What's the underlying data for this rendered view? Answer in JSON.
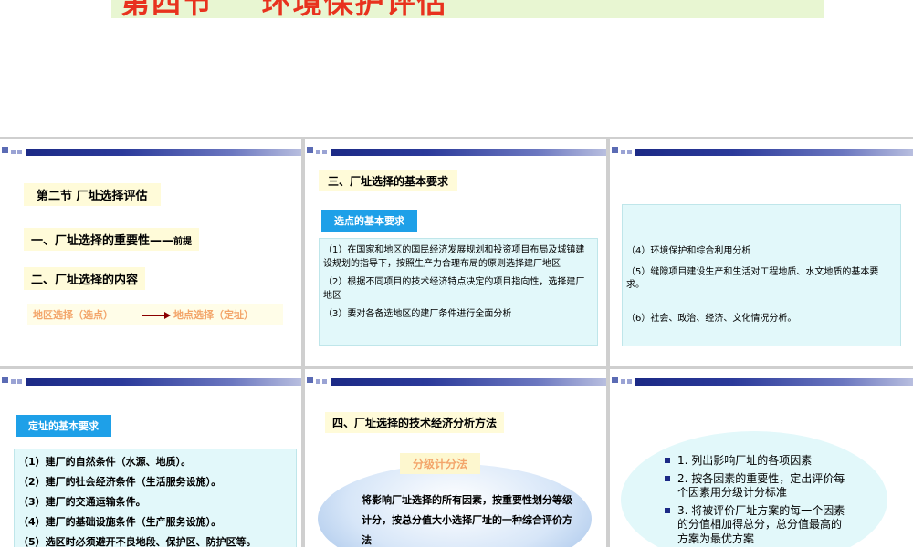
{
  "page_title": "第四节    环境保护评估",
  "slide1": {
    "section": "第二节  厂址选择评估",
    "item1_main": "一、厂址选择的重要性——",
    "item1_suffix": "前提",
    "item2": "二、厂址选择的内容",
    "from": "地区选择（选点）",
    "to": "地点选择（定址）"
  },
  "slide2": {
    "heading": "三、厂址选择的基本要求",
    "badge": "选点的基本要求",
    "items": [
      "（1）在国家和地区的国民经济发展规划和投资项目布局及城镇建设规划的指导下，按照生产力合理布局的原则选择建厂地区",
      "（2）根据不同项目的技术经济特点决定的项目指向性，选择建厂地区",
      "（3）要对各备选地区的建厂条件进行全面分析"
    ]
  },
  "slide3": {
    "items": [
      "（4）环境保护和综合利用分析",
      "（5）缝隙项目建设生产和生活对工程地质、水文地质的基本要求。",
      "（6）社会、政治、经济、文化情况分析。"
    ]
  },
  "slide4": {
    "badge": "定址的基本要求",
    "items": [
      "（1）建厂的自然条件（水源、地质）。",
      "（2）建厂的社会经济条件（生活服务设施）。",
      "（3）建厂的交通运输条件。",
      "（4）建厂的基础设施条件（生产服务设施）。",
      "（5）选区时必须避开不良地段、保护区、防护区等。"
    ]
  },
  "slide5": {
    "heading": "四、厂址选择的技术经济分析方法",
    "method": "分级计分法",
    "description": "将影响厂址选择的所有因素，按重要性划分等级计分，按总分值大小选择厂址的一种综合评价方法"
  },
  "slide6": {
    "steps": [
      "1.  列出影响厂址的各项因素",
      "2.  按各因素的重要性，定出评价每个因素用分级计分标准",
      "3.  将被评价厂址方案的每一个因素的分值相加得总分，总分值最高的方案为最优方案"
    ]
  },
  "colors": {
    "title_red": "#e8321e",
    "banner_blue": "#1c2a86",
    "badge_blue": "#1ea0e8",
    "orange_text": "#f3a56a",
    "arrow_red": "#8b0000"
  }
}
